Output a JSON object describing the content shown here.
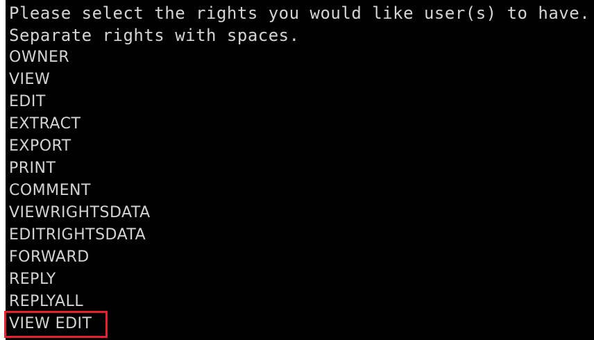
{
  "prompt": {
    "line1": "Please select the rights you would like user(s) to have.",
    "line2": "Separate rights with spaces."
  },
  "rights": [
    "OWNER",
    "VIEW",
    "EDIT",
    "EXTRACT",
    "EXPORT",
    "PRINT",
    "COMMENT",
    "VIEWRIGHTSDATA",
    "EDITRIGHTSDATA",
    "FORWARD",
    "REPLY",
    "REPLYALL"
  ],
  "input": {
    "value": "VIEW EDIT"
  },
  "colors": {
    "background": "#000000",
    "text": "#d4d4d4",
    "highlight": "#e8202a"
  }
}
